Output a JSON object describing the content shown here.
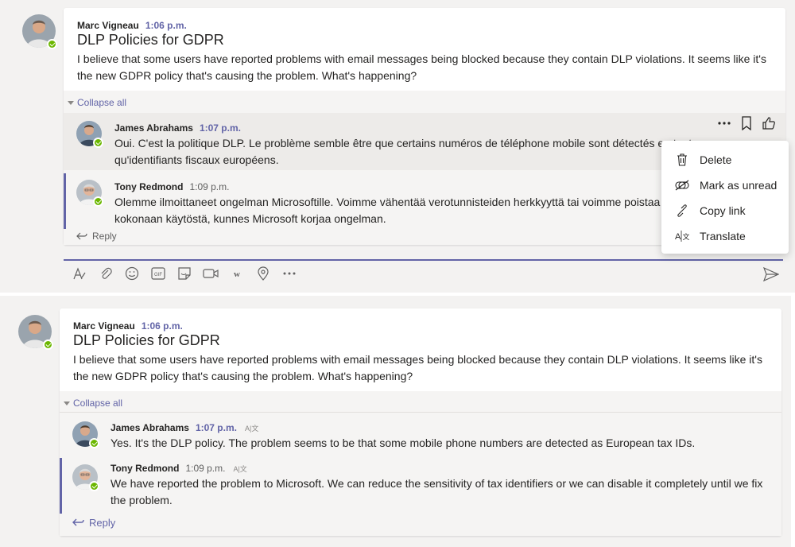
{
  "top": {
    "post": {
      "author": "Marc Vigneau",
      "time": "1:06 p.m.",
      "subject": "DLP Policies for GDPR",
      "body": "I believe that some users have reported problems with email messages being blocked because they contain DLP violations. It seems like it's the new GDPR policy that's causing the problem. What's happening?"
    },
    "collapse_label": "Collapse all",
    "replies": [
      {
        "author": "James Abrahams",
        "time": "1:07 p.m.",
        "body": "Oui. C'est la politique DLP. Le problème semble être que certains numéros de téléphone mobile sont détectés en tant qu'identifiants fiscaux européens."
      },
      {
        "author": "Tony Redmond",
        "time": "1:09 p.m.",
        "body": "Olemme ilmoittaneet ongelman Microsoftille. Voimme vähentää verotunnisteiden herkkyyttä tai voimme poistaa sen kokonaan käytöstä, kunnes Microsoft korjaa ongelman."
      }
    ],
    "reply_label": "Reply",
    "context_menu": [
      {
        "label": "Delete",
        "icon": "trash-icon"
      },
      {
        "label": "Mark as unread",
        "icon": "mark-unread-icon"
      },
      {
        "label": "Copy link",
        "icon": "link-icon"
      },
      {
        "label": "Translate",
        "icon": "translate-icon"
      }
    ],
    "hover_actions": [
      "more-options-icon",
      "bookmark-icon",
      "like-icon"
    ],
    "toolbar_icons": [
      "format-icon",
      "attach-icon",
      "emoji-icon",
      "gif-icon",
      "sticker-icon",
      "meet-now-icon",
      "wiki-icon",
      "location-icon",
      "more-apps-icon"
    ],
    "send_icon": "send-icon"
  },
  "bottom": {
    "post": {
      "author": "Marc Vigneau",
      "time": "1:06 p.m.",
      "subject": "DLP Policies for GDPR",
      "body": "I believe that some users have reported problems with email messages being blocked because they contain DLP violations. It seems like it's the new GDPR policy that's causing the problem. What's happening?"
    },
    "collapse_label": "Collapse all",
    "replies": [
      {
        "author": "James Abrahams",
        "time": "1:07 p.m.",
        "body": "Yes. It's the DLP policy. The problem seems to be that some mobile phone numbers are detected as European tax IDs."
      },
      {
        "author": "Tony Redmond",
        "time": "1:09 p.m.",
        "body": "We have reported the problem to Microsoft. We can reduce the sensitivity of tax identifiers or we can disable it completely until we fix the problem."
      }
    ],
    "reply_label": "Reply"
  },
  "colors": {
    "accent": "#6264a7",
    "presence": "#6bb700",
    "background": "#f3f2f1"
  }
}
